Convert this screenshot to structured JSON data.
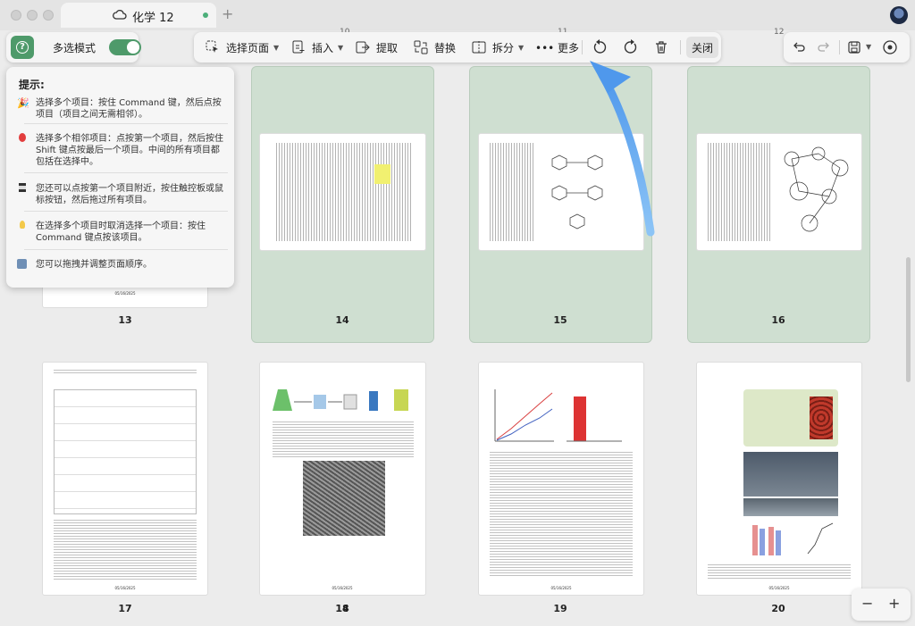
{
  "window": {
    "tab_title": "化学 12",
    "tab_icon": "cloud-icon",
    "new_tab": "+"
  },
  "left_panel": {
    "help_icon": "question-icon",
    "multi_label": "多选模式",
    "multi_on": true
  },
  "toolbar": {
    "select_page": "选择页面",
    "insert": "插入",
    "extract": "提取",
    "replace": "替换",
    "split": "拆分",
    "more": "••• 更多",
    "close": "关闭"
  },
  "hint": {
    "title": "提示:",
    "items": [
      "选择多个项目：按住 Command 键，然后点按项目（项目之间无需相邻）。",
      "选择多个相邻项目：点按第一个项目，然后按住 Shift 键点按最后一个项目。中间的所有项目都包括在选择中。",
      "您还可以点按第一个项目附近，按住触控板或鼠标按钮，然后拖过所有项目。",
      "在选择多个项目时取消选择一个项目：按住 Command 键点按该项目。",
      "您可以拖拽并调整页面顺序。"
    ]
  },
  "top_edge_labels": [
    "10",
    "11",
    "12"
  ],
  "pages_row1": [
    {
      "num": "13",
      "selected": false,
      "date": "05/16/2025"
    },
    {
      "num": "14",
      "selected": true
    },
    {
      "num": "15",
      "selected": true
    },
    {
      "num": "16",
      "selected": true
    }
  ],
  "pages_row2": [
    {
      "num": "17",
      "date": "05/16/2025"
    },
    {
      "num": "18",
      "date": "05/16/2025"
    },
    {
      "num": "19",
      "date": "05/16/2025"
    },
    {
      "num": "20",
      "date": "05/16/2025"
    }
  ],
  "zoom": {
    "out": "−",
    "in": "+"
  },
  "colors": {
    "accent": "#4e9a6a",
    "selection": "#cfdfd1",
    "arrow": "#5aa2ee"
  }
}
